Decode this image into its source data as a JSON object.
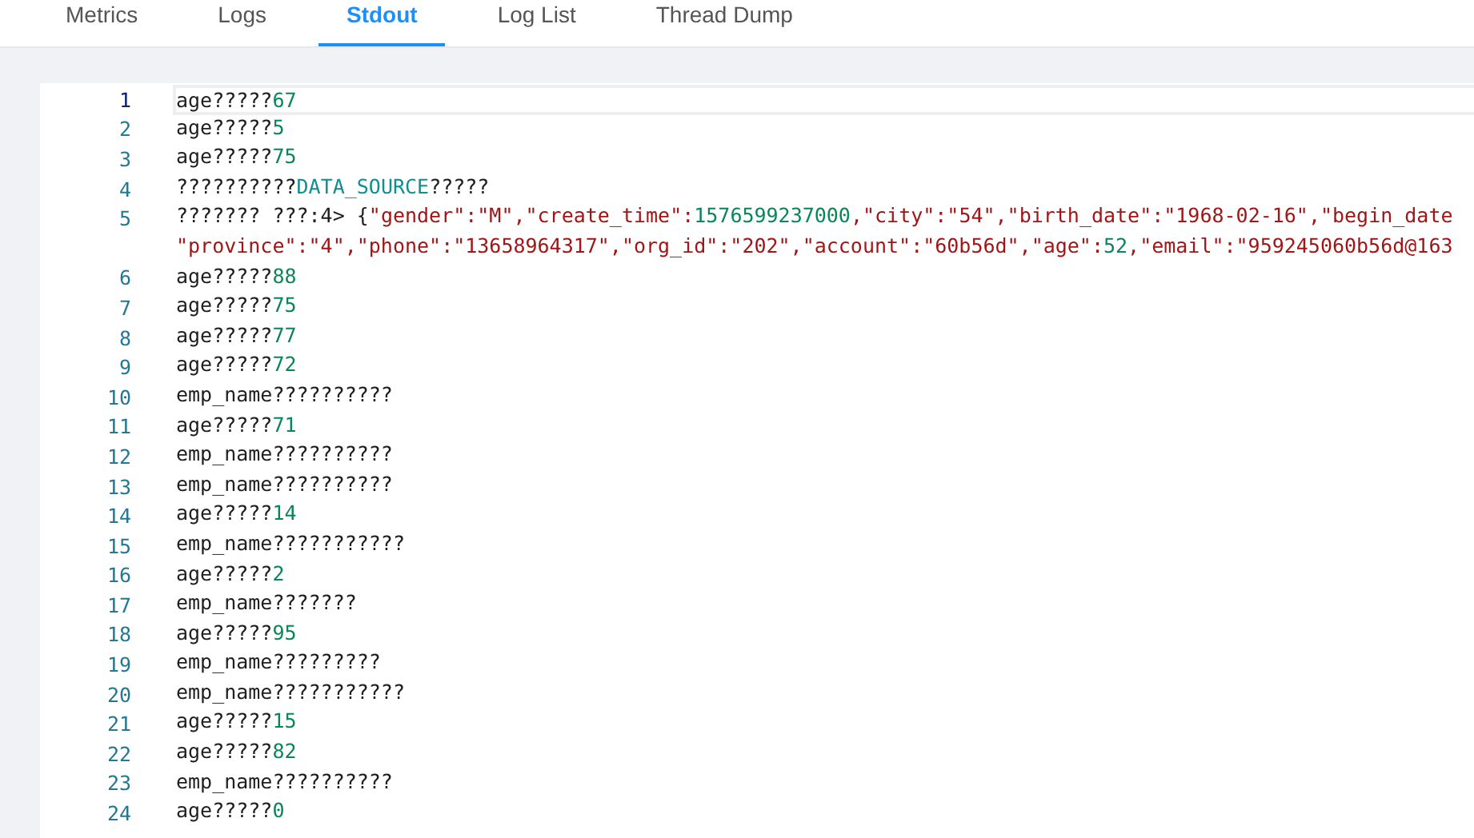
{
  "tabs": [
    {
      "label": "Metrics",
      "selected": false
    },
    {
      "label": "Logs",
      "selected": false
    },
    {
      "label": "Stdout",
      "selected": true
    },
    {
      "label": "Log List",
      "selected": false
    },
    {
      "label": "Thread Dump",
      "selected": false
    }
  ],
  "editor": {
    "lines": [
      {
        "number": "1",
        "active": true,
        "segments": [
          {
            "kind": "text",
            "text": "age?????"
          },
          {
            "kind": "number",
            "text": "67"
          }
        ]
      },
      {
        "number": "2",
        "active": false,
        "segments": [
          {
            "kind": "text",
            "text": "age?????"
          },
          {
            "kind": "number",
            "text": "5"
          }
        ]
      },
      {
        "number": "3",
        "active": false,
        "segments": [
          {
            "kind": "text",
            "text": "age?????"
          },
          {
            "kind": "number",
            "text": "75"
          }
        ]
      },
      {
        "number": "4",
        "active": false,
        "segments": [
          {
            "kind": "text",
            "text": "??????????"
          },
          {
            "kind": "keyword",
            "text": "DATA_SOURCE"
          },
          {
            "kind": "text",
            "text": "?????"
          }
        ]
      },
      {
        "number": "5",
        "active": false,
        "segments": [
          {
            "kind": "text",
            "text": "??????? ???:4> {"
          },
          {
            "kind": "string",
            "text": "\"gender\":\"M\",\"create_time\":"
          },
          {
            "kind": "number",
            "text": "1576599237000"
          },
          {
            "kind": "string",
            "text": ",\"city\":\"54\",\"birth_date\":\"1968-02-16\",\"begin_date"
          }
        ],
        "continuation": [
          {
            "kind": "string",
            "text": "\"province\":\"4\",\"phone\":\"13658964317\",\"org_id\":\"202\",\"account\":\"60b56d\",\"age\":"
          },
          {
            "kind": "number",
            "text": "52"
          },
          {
            "kind": "string",
            "text": ",\"email\":\"959245060b56d@163"
          }
        ]
      },
      {
        "number": "6",
        "active": false,
        "segments": [
          {
            "kind": "text",
            "text": "age?????"
          },
          {
            "kind": "number",
            "text": "88"
          }
        ]
      },
      {
        "number": "7",
        "active": false,
        "segments": [
          {
            "kind": "text",
            "text": "age?????"
          },
          {
            "kind": "number",
            "text": "75"
          }
        ]
      },
      {
        "number": "8",
        "active": false,
        "segments": [
          {
            "kind": "text",
            "text": "age?????"
          },
          {
            "kind": "number",
            "text": "77"
          }
        ]
      },
      {
        "number": "9",
        "active": false,
        "segments": [
          {
            "kind": "text",
            "text": "age?????"
          },
          {
            "kind": "number",
            "text": "72"
          }
        ]
      },
      {
        "number": "10",
        "active": false,
        "segments": [
          {
            "kind": "text",
            "text": "emp_name??????????"
          }
        ]
      },
      {
        "number": "11",
        "active": false,
        "segments": [
          {
            "kind": "text",
            "text": "age?????"
          },
          {
            "kind": "number",
            "text": "71"
          }
        ]
      },
      {
        "number": "12",
        "active": false,
        "segments": [
          {
            "kind": "text",
            "text": "emp_name??????????"
          }
        ]
      },
      {
        "number": "13",
        "active": false,
        "segments": [
          {
            "kind": "text",
            "text": "emp_name??????????"
          }
        ]
      },
      {
        "number": "14",
        "active": false,
        "segments": [
          {
            "kind": "text",
            "text": "age?????"
          },
          {
            "kind": "number",
            "text": "14"
          }
        ]
      },
      {
        "number": "15",
        "active": false,
        "segments": [
          {
            "kind": "text",
            "text": "emp_name???????????"
          }
        ]
      },
      {
        "number": "16",
        "active": false,
        "segments": [
          {
            "kind": "text",
            "text": "age?????"
          },
          {
            "kind": "number",
            "text": "2"
          }
        ]
      },
      {
        "number": "17",
        "active": false,
        "segments": [
          {
            "kind": "text",
            "text": "emp_name???????"
          }
        ]
      },
      {
        "number": "18",
        "active": false,
        "segments": [
          {
            "kind": "text",
            "text": "age?????"
          },
          {
            "kind": "number",
            "text": "95"
          }
        ]
      },
      {
        "number": "19",
        "active": false,
        "segments": [
          {
            "kind": "text",
            "text": "emp_name?????????"
          }
        ]
      },
      {
        "number": "20",
        "active": false,
        "segments": [
          {
            "kind": "text",
            "text": "emp_name???????????"
          }
        ]
      },
      {
        "number": "21",
        "active": false,
        "segments": [
          {
            "kind": "text",
            "text": "age?????"
          },
          {
            "kind": "number",
            "text": "15"
          }
        ]
      },
      {
        "number": "22",
        "active": false,
        "segments": [
          {
            "kind": "text",
            "text": "age?????"
          },
          {
            "kind": "number",
            "text": "82"
          }
        ]
      },
      {
        "number": "23",
        "active": false,
        "segments": [
          {
            "kind": "text",
            "text": "emp_name??????????"
          }
        ]
      },
      {
        "number": "24",
        "active": false,
        "segments": [
          {
            "kind": "text",
            "text": "age?????"
          },
          {
            "kind": "number",
            "text": "0"
          }
        ]
      }
    ]
  }
}
